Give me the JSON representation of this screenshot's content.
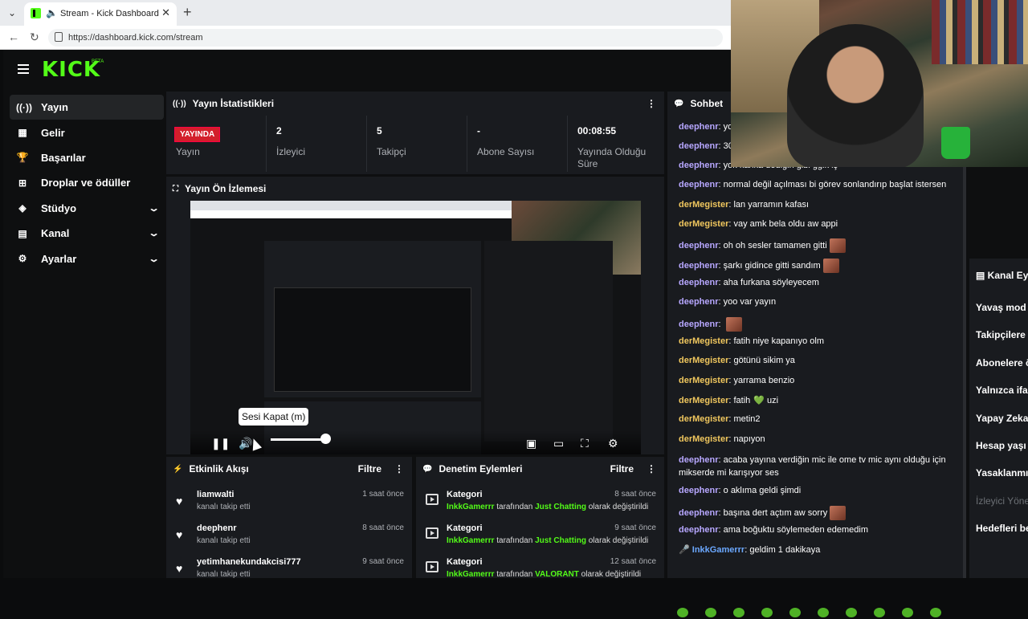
{
  "browser": {
    "tab_title": "Stream - Kick Dashboard",
    "url": "https://dashboard.kick.com/stream",
    "new_tab": "+",
    "close": "✕"
  },
  "brand": {
    "logo": "KICK",
    "beta": "BETA"
  },
  "sidebar": {
    "items": [
      {
        "label": "Yayın",
        "icon": "broadcast-icon",
        "active": true
      },
      {
        "label": "Gelir",
        "icon": "revenue-icon"
      },
      {
        "label": "Başarılar",
        "icon": "trophy-icon"
      },
      {
        "label": "Droplar ve ödüller",
        "icon": "gift-icon"
      },
      {
        "label": "Stüdyo",
        "icon": "studio-icon",
        "expandable": true
      },
      {
        "label": "Kanal",
        "icon": "channel-icon",
        "expandable": true
      },
      {
        "label": "Ayarlar",
        "icon": "gear-icon",
        "expandable": true
      }
    ]
  },
  "stats": {
    "title": "Yayın İstatistikleri",
    "live_badge": "YAYINDA",
    "cells": [
      {
        "value": "",
        "label": "Yayın"
      },
      {
        "value": "2",
        "label": "İzleyici"
      },
      {
        "value": "5",
        "label": "Takipçi"
      },
      {
        "value": "-",
        "label": "Abone Sayısı"
      },
      {
        "value": "00:08:55",
        "label": "Yayında Olduğu Süre"
      }
    ]
  },
  "preview": {
    "title": "Yayın Ön İzlemesi",
    "tooltip": "Sesi Kapat (m)",
    "volume_level": 0.85
  },
  "activity": {
    "title": "Etkinlik Akışı",
    "filter": "Filtre",
    "rows": [
      {
        "name": "liamwalti",
        "sub": "kanalı takip etti",
        "time": "1 saat önce"
      },
      {
        "name": "deephenr",
        "sub": "kanalı takip etti",
        "time": "8 saat önce"
      },
      {
        "name": "yetimhanekundakcisi777",
        "sub": "kanalı takip etti",
        "time": "9 saat önce"
      }
    ]
  },
  "moderation": {
    "title": "Denetim Eylemleri",
    "filter": "Filtre",
    "rows": [
      {
        "name": "Kategori",
        "by": "InkkGamerrr",
        "mid": " tarafından ",
        "cat": "Just Chatting",
        "end": " olarak değiştirildi",
        "time": "8 saat önce"
      },
      {
        "name": "Kategori",
        "by": "InkkGamerrr",
        "mid": " tarafından ",
        "cat": "Just Chatting",
        "end": " olarak değiştirildi",
        "time": "9 saat önce"
      },
      {
        "name": "Kategori",
        "by": "InkkGamerrr",
        "mid": " tarafından ",
        "cat": "VALORANT",
        "end": " olarak değiştirildi",
        "time": "12 saat önce"
      }
    ]
  },
  "chat": {
    "title": "Sohbet",
    "messages": [
      {
        "user": "deephenr",
        "type": "d",
        "text": "yo"
      },
      {
        "user": "deephenr",
        "type": "d",
        "text": "30"
      },
      {
        "user": "deephenr",
        "type": "d",
        "text": "yok kanka dediğin gibi ggik iş"
      },
      {
        "user": "deephenr",
        "type": "d",
        "text": "normal değil açılması bi görev sonlandırıp başlat istersen"
      },
      {
        "user": "derMegister",
        "type": "m",
        "text": "lan yarramın kafası"
      },
      {
        "user": "derMegister",
        "type": "m",
        "text": "vay amk bela oldu aw appi"
      },
      {
        "user": "deephenr",
        "type": "d",
        "text": "oh oh sesler tamamen gitti",
        "emote": true
      },
      {
        "user": "deephenr",
        "type": "d",
        "text": "şarkı gidince gitti sandım",
        "emote": true
      },
      {
        "user": "deephenr",
        "type": "d",
        "text": "aha furkana söyleyecem"
      },
      {
        "user": "deephenr",
        "type": "d",
        "text": "yoo var yayın"
      },
      {
        "user": "deephenr",
        "type": "d",
        "text": "",
        "emote": true
      },
      {
        "user": "derMegister",
        "type": "m",
        "text": "fatih niye kapanıyo olm"
      },
      {
        "user": "derMegister",
        "type": "m",
        "text": "götünü sikim ya"
      },
      {
        "user": "derMegister",
        "type": "m",
        "text": "yarrama benzio"
      },
      {
        "user": "derMegister",
        "type": "m",
        "text": "fatih",
        "heart": "💚",
        "tail": " uzi"
      },
      {
        "user": "derMegister",
        "type": "m",
        "text": "metin2"
      },
      {
        "user": "derMegister",
        "type": "m",
        "text": "napıyon"
      },
      {
        "user": "deephenr",
        "type": "d",
        "text": "acaba yayına verdiğin mic ile ome tv mic aynı olduğu için",
        "line2": "mikserde mi karışıyor ses"
      },
      {
        "user": "deephenr",
        "type": "d",
        "text": "o aklıma geldi şimdi"
      },
      {
        "user": "deephenr",
        "type": "d",
        "text": "başına dert açtım aw sorry",
        "emote": true
      },
      {
        "user": "deephenr",
        "type": "d",
        "text": "ama boğuktu söylemeden edemedim"
      },
      {
        "user": "InkkGamerrr",
        "type": "i",
        "text": "geldim 1 dakikaya",
        "badge": "🎤"
      }
    ]
  },
  "right_panel": {
    "title": "Kanal Eyle",
    "items": [
      {
        "label": "Yavaş mod"
      },
      {
        "label": "Takipçilere öz"
      },
      {
        "label": "Abonelere öz"
      },
      {
        "label": "Yalnızca ifad"
      },
      {
        "label": "Yapay Zeka il"
      },
      {
        "label": "Hesap yaşı k"
      },
      {
        "label": "Yasaklanmış"
      },
      {
        "label": "İzleyici Yöne",
        "dim": true
      },
      {
        "label": "Hedefleri bel"
      }
    ]
  }
}
